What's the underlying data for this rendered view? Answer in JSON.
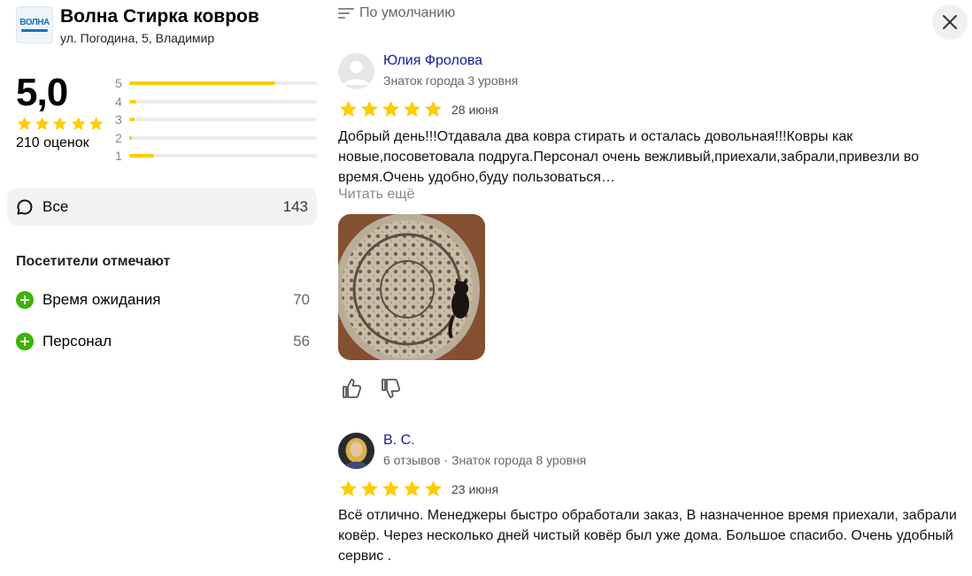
{
  "organization": {
    "logo_text": "ВОЛНА",
    "name": "Волна Стирка ковров",
    "address": "ул. Погодина, 5, Владимир"
  },
  "rating": {
    "value": "5,0",
    "stars": 5,
    "count_label": "210 оценок",
    "distribution": [
      {
        "label": "5",
        "fraction": 0.78
      },
      {
        "label": "4",
        "fraction": 0.04
      },
      {
        "label": "3",
        "fraction": 0.03
      },
      {
        "label": "2",
        "fraction": 0.015
      },
      {
        "label": "1",
        "fraction": 0.13
      }
    ]
  },
  "filters": {
    "all_label": "Все",
    "all_count": "143"
  },
  "aspects": {
    "title": "Посетители отмечают",
    "items": [
      {
        "label": "Время ожидания",
        "count": "70"
      },
      {
        "label": "Персонал",
        "count": "56"
      }
    ]
  },
  "sort": {
    "label": "По умолчанию"
  },
  "colors": {
    "star": "#fc0",
    "accent_green": "#3bb300",
    "author_link": "#1a1a99"
  },
  "reviews": [
    {
      "author": "Юлия Фролова",
      "meta": "Знаток города 3 уровня",
      "stars": 5,
      "date": "28 июня",
      "text": "Добрый день!!!Отдавала два ковра стирать и осталась довольная!!!Ковры как новые,посоветовала подруга.Персонал очень вежливый,приехали,забрали,привезли во время.Очень удобно,буду пользоваться…",
      "read_more": "Читать ещё"
    },
    {
      "author": "В. С.",
      "meta": "6 отзывов · Знаток города 8 уровня",
      "stars": 5,
      "date": "23 июня",
      "text": "Всё отлично. Менеджеры быстро обработали заказ, В назначенное время приехали, забрали ковёр. Через несколько дней чистый ковёр был уже дома. Большое спасибо. Очень удобный сервис ."
    }
  ]
}
